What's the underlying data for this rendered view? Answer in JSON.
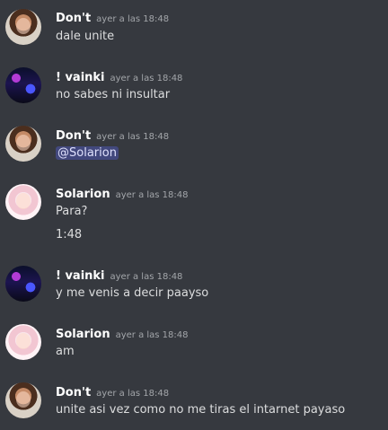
{
  "messages": [
    {
      "author": "Don't",
      "time": "ayer a las 18:48",
      "avatar": "avatar-dont",
      "lines": [
        "dale unite"
      ]
    },
    {
      "author": "! vainki",
      "time": "ayer a las 18:48",
      "avatar": "avatar-vainki",
      "lines": [
        "no sabes ni insultar"
      ]
    },
    {
      "author": "Don't",
      "time": "ayer a las 18:48",
      "avatar": "avatar-dont",
      "lines": [
        "@Solarion"
      ]
    },
    {
      "author": "Solarion",
      "time": "ayer a las 18:48",
      "avatar": "avatar-solarion",
      "lines": [
        "Para?",
        "1:48"
      ]
    },
    {
      "author": "! vainki",
      "time": "ayer a las 18:48",
      "avatar": "avatar-vainki",
      "lines": [
        "y me venis a decir paayso"
      ]
    },
    {
      "author": "Solarion",
      "time": "ayer a las 18:48",
      "avatar": "avatar-solarion",
      "lines": [
        "am"
      ]
    },
    {
      "author": "Don't",
      "time": "ayer a las 18:48",
      "avatar": "avatar-dont",
      "lines": [
        "unite asi vez como no me tiras el intarnet payaso"
      ]
    }
  ],
  "colors": {
    "background": "#36393f",
    "mention_bg": "#5865f2"
  }
}
